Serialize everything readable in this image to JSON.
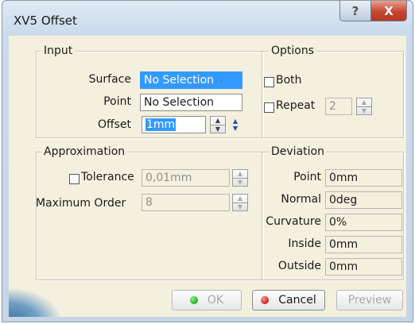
{
  "window": {
    "title": "XV5 Offset",
    "help_label": "?",
    "close_label": "X"
  },
  "input": {
    "legend": "Input",
    "surface_label": "Surface",
    "surface_value": "No Selection",
    "point_label": "Point",
    "point_value": "No Selection",
    "offset_label": "Offset",
    "offset_value": "1mm"
  },
  "options": {
    "legend": "Options",
    "both_label": "Both",
    "repeat_label": "Repeat",
    "repeat_value": "2"
  },
  "approximation": {
    "legend": "Approximation",
    "tolerance_label": "Tolerance",
    "tolerance_value": "0,01mm",
    "max_order_label": "Maximum Order",
    "max_order_value": "8"
  },
  "deviation": {
    "legend": "Deviation",
    "rows": [
      {
        "label": "Point",
        "value": "0mm"
      },
      {
        "label": "Normal",
        "value": "0deg"
      },
      {
        "label": "Curvature",
        "value": "0%"
      },
      {
        "label": "Inside",
        "value": "0mm"
      },
      {
        "label": "Outside",
        "value": "0mm"
      }
    ]
  },
  "buttons": {
    "ok": "OK",
    "cancel": "Cancel",
    "preview": "Preview"
  },
  "colors": {
    "ok_dot": "#2bb52b",
    "cancel_dot": "#d92b2b",
    "selection": "#3399ff"
  }
}
